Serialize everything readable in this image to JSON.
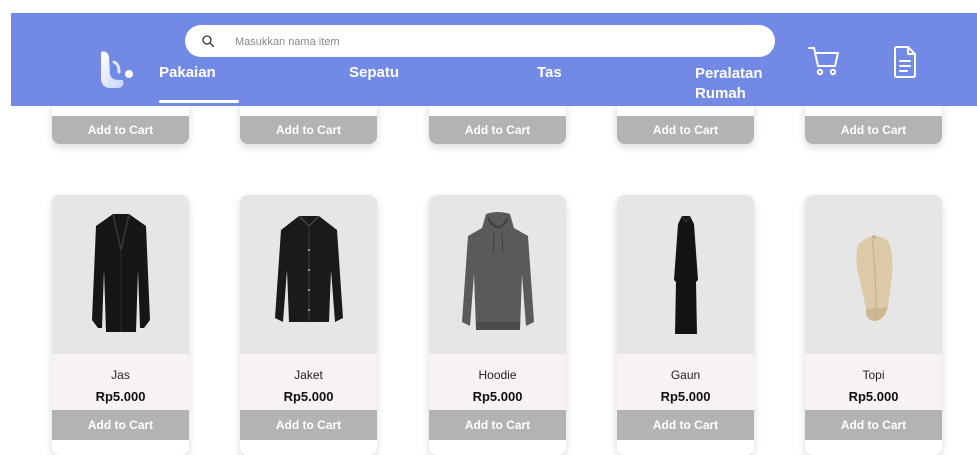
{
  "search": {
    "placeholder": "Masukkan nama item"
  },
  "nav": [
    {
      "label": "Pakaian",
      "active": true
    },
    {
      "label": "Sepatu",
      "active": false
    },
    {
      "label": "Tas",
      "active": false
    },
    {
      "label": "Peralatan Rumah",
      "active": false
    }
  ],
  "header_icons": {
    "cart": "cart-icon",
    "document": "document-icon"
  },
  "top_row": {
    "cart_label": "Add to Cart"
  },
  "products": [
    {
      "name": "Jas",
      "price": "Rp5.000",
      "cart_label": "Add to Cart",
      "icon": "blazer-icon"
    },
    {
      "name": "Jaket",
      "price": "Rp5.000",
      "cart_label": "Add to Cart",
      "icon": "jacket-icon"
    },
    {
      "name": "Hoodie",
      "price": "Rp5.000",
      "cart_label": "Add to Cart",
      "icon": "hoodie-icon"
    },
    {
      "name": "Gaun",
      "price": "Rp5.000",
      "cart_label": "Add to Cart",
      "icon": "dress-icon"
    },
    {
      "name": "Topi",
      "price": "Rp5.000",
      "cart_label": "Add to Cart",
      "icon": "cap-icon"
    }
  ],
  "colors": {
    "header": "#7289e6",
    "button": "#b3b3b3",
    "image_bg": "#e6e6e6",
    "info_bg": "#f7f3f2"
  }
}
